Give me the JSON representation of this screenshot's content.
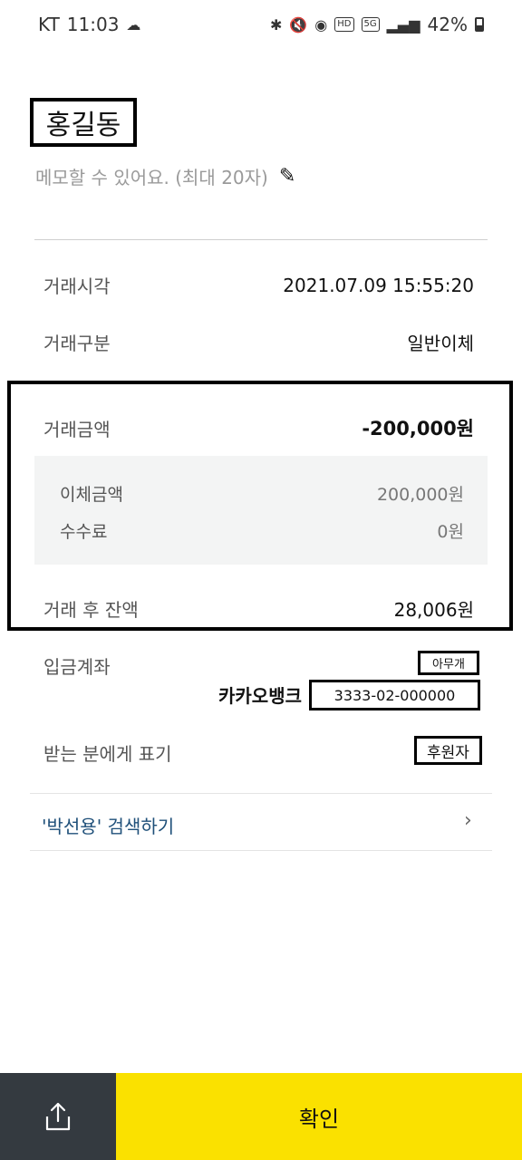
{
  "status_bar": {
    "carrier": "KT",
    "time": "11:03",
    "network": "5G",
    "hd": "HD",
    "battery": "42%"
  },
  "header": {
    "recipient_name": "홍길동",
    "memo_placeholder": "메모할 수 있어요. (최대 20자)"
  },
  "details": {
    "time_label": "거래시각",
    "time_value": "2021.07.09 15:55:20",
    "type_label": "거래구분",
    "type_value": "일반이체",
    "amount_label": "거래금액",
    "amount_value": "-200,000원",
    "transfer_label": "이체금액",
    "transfer_value": "200,000원",
    "fee_label": "수수료",
    "fee_value": "0원",
    "balance_label": "거래 후 잔액",
    "balance_value": "28,006원",
    "deposit_label": "입금계좌",
    "account_holder": "아무개",
    "bank_name": "카카오뱅크",
    "account_number": "3333-02-000000",
    "display_label": "받는 분에게 표기",
    "display_value": "후원자"
  },
  "search": {
    "link_text": "'박선용' 검색하기"
  },
  "bottom": {
    "confirm_label": "확인"
  }
}
